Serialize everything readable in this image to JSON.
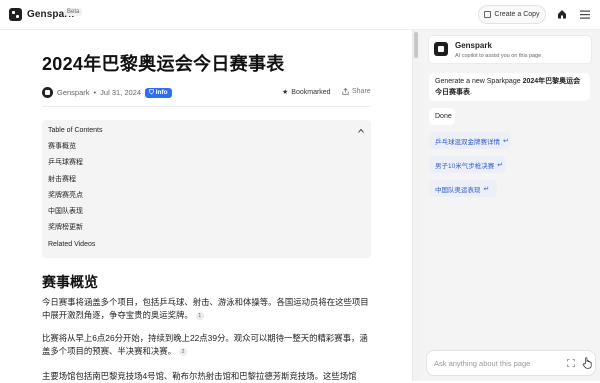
{
  "header": {
    "brand": "Genspark",
    "beta": "Beta",
    "create_copy": "Create a Copy"
  },
  "article": {
    "title": "2024年巴黎奥运会今日赛事表",
    "author": "Genspark",
    "date": "Jul 31, 2024",
    "badge": "Info",
    "bookmarked": "Bookmarked",
    "share": "Share"
  },
  "toc": {
    "title": "Table of Contents",
    "items": [
      "赛事概览",
      "乒乓球赛程",
      "射击赛程",
      "奖牌赛亮点",
      "中国队表现",
      "奖牌榜更新",
      "Related Videos"
    ]
  },
  "section": {
    "heading": "赛事概览",
    "p1": "今日赛事将涵盖多个项目，包括乒乓球、射击、游泳和体操等。各国运动员将在这些项目中展开激烈角逐，争夺宝贵的奥运奖牌。",
    "p1_cite": "1",
    "p2": "比赛将从早上6点26分开始，持续到晚上22点39分。观众可以期待一整天的精彩赛事，涵盖多个项目的预赛、半决赛和决赛。",
    "p2_cite": "2",
    "p3": "主要场馆包括南巴黎竞技场4号馆、勒布尔热射击馆和巴黎拉德芳斯竞技场。这些场馆"
  },
  "assistant": {
    "name": "Genspark",
    "subtitle": "AI copilot to assist you on this page",
    "prompt_prefix": "Generate a new Sparkpage ",
    "prompt_bold": "2024年巴黎奥运会今日赛事表",
    "prompt_suffix": ".",
    "reply": "Done",
    "links": [
      "乒乓球混双金牌赛详情",
      "男子10米气步枪决赛",
      "中国队奥运表现"
    ],
    "input_placeholder": "Ask anything about this page"
  },
  "colors": {
    "accent": "#2f6ef2",
    "link": "#2f5fd0",
    "panel_bg": "#f4f4f4"
  }
}
